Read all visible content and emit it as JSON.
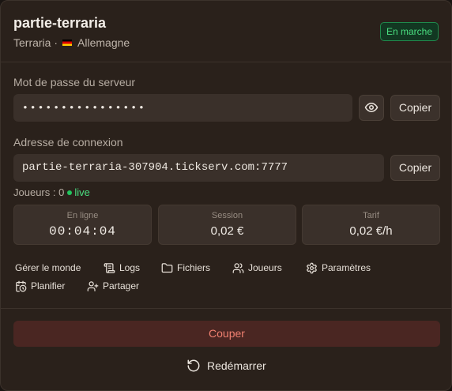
{
  "server": {
    "name": "partie-terraria",
    "game": "Terraria",
    "separator": "·",
    "location": "Allemagne",
    "status": "En marche"
  },
  "password": {
    "label": "Mot de passe du serveur",
    "value": "••••••••••••••••",
    "copy_label": "Copier",
    "reveal_icon": "eye-icon"
  },
  "connection": {
    "label": "Adresse de connexion",
    "address": "partie-terraria-307904.tickserv.com:7777",
    "copy_label": "Copier"
  },
  "players": {
    "text": "Joueurs : 0",
    "live_label": "live"
  },
  "stats": [
    {
      "label": "En ligne",
      "value": "00:04:04"
    },
    {
      "label": "Session",
      "value": "0,02 €"
    },
    {
      "label": "Tarif",
      "value": "0,02 €/h"
    }
  ],
  "actions": {
    "manage": "Gérer le monde",
    "logs": "Logs",
    "files": "Fichiers",
    "players": "Joueurs",
    "settings": "Paramètres",
    "schedule": "Planifier",
    "share": "Partager"
  },
  "controls": {
    "stop": "Couper",
    "restart": "Redémarrer"
  },
  "colors": {
    "background": "#2a211b",
    "accent_green": "#4ade80",
    "stop_bg": "#4a2622",
    "stop_text": "#f08070"
  }
}
